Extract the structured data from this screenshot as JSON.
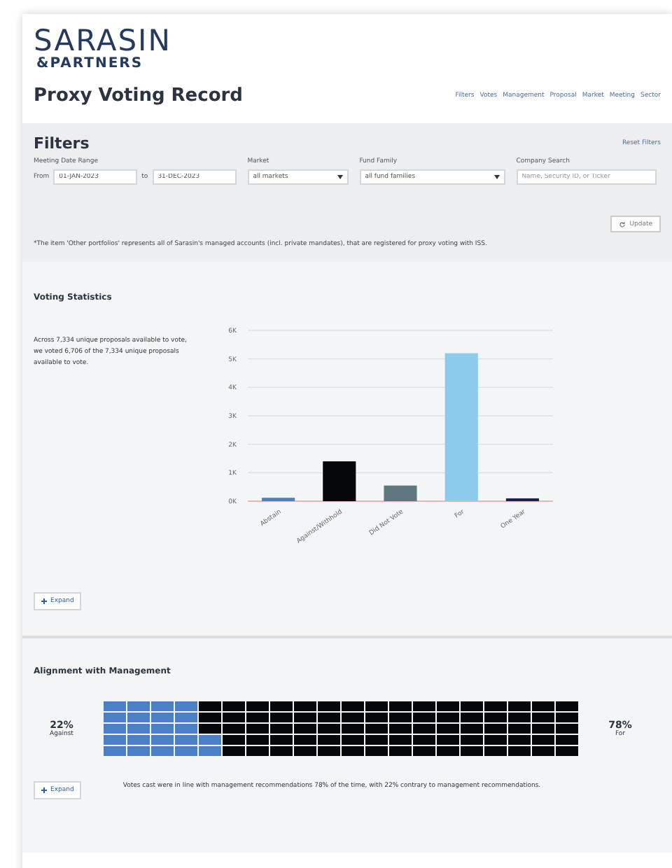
{
  "brand": {
    "name": "SARASIN",
    "sub": "&PARTNERS"
  },
  "page_title": "Proxy Voting Record",
  "nav": [
    "Filters",
    "Votes",
    "Management",
    "Proposal",
    "Market",
    "Meeting",
    "Sector"
  ],
  "filters": {
    "title": "Filters",
    "reset": "Reset Filters",
    "date_range": {
      "label": "Meeting Date Range",
      "from_label": "From",
      "from": "01-JAN-2023",
      "to_label": "to",
      "to": "31-DEC-2023"
    },
    "market": {
      "label": "Market",
      "value": "all markets"
    },
    "fund_family": {
      "label": "Fund Family",
      "value": "all fund families"
    },
    "company_search": {
      "label": "Company Search",
      "placeholder": "Name, Security ID, or Ticker"
    },
    "update": "Update",
    "footnote": "*The item 'Other portfolios' represents all of Sarasin's managed accounts (incl. private mandates), that are registered for proxy voting with ISS."
  },
  "voting_statistics": {
    "title": "Voting Statistics",
    "summary": "Across 7,334 unique proposals available to vote, we voted 6,706 of the 7,334 unique proposals available to vote.",
    "expand": "Expand",
    "chart_data": {
      "type": "bar",
      "categories": [
        "Abstain",
        "Against/Withhold",
        "Did Not Vote",
        "For",
        "One Year"
      ],
      "values": [
        120,
        1400,
        550,
        5200,
        100
      ],
      "grid": true,
      "colors": [
        "#4a7fc9",
        "#05070b",
        "#5f7880",
        "#8ccbec",
        "#1c2050"
      ],
      "ylim": [
        0,
        6000
      ],
      "yticks": [
        {
          "value": 0,
          "label": "0K"
        },
        {
          "value": 1000,
          "label": "1K"
        },
        {
          "value": 2000,
          "label": "2K"
        },
        {
          "value": 3000,
          "label": "3K"
        },
        {
          "value": 4000,
          "label": "4K"
        },
        {
          "value": 5000,
          "label": "5K"
        },
        {
          "value": 6000,
          "label": "6K"
        }
      ]
    }
  },
  "alignment": {
    "title": "Alignment with Management",
    "against": {
      "percent": "22%",
      "label": "Against"
    },
    "for": {
      "percent": "78%",
      "label": "For"
    },
    "expand": "Expand",
    "summary": "Votes cast were in line with management recommendations 78% of the time, with 22% contrary to management recommendations."
  }
}
